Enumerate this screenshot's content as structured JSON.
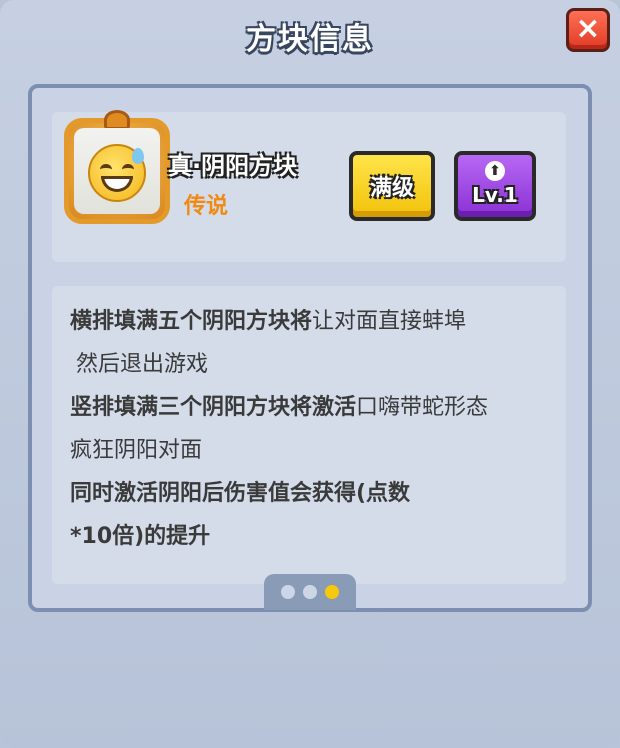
{
  "dialog": {
    "title": "方块信息",
    "close_icon": "×"
  },
  "item": {
    "name": "真·阴阳方块",
    "rarity": "传说",
    "icon": "sweat-smile-emoji-icon",
    "frame": "dragon-frame",
    "max_label": "满级",
    "level_label": "Lv.1",
    "upgrade_icon": "⬆"
  },
  "description": {
    "lines": [
      {
        "bold": "横排填满五个阴阳方块将",
        "normal": "让对面直接蚌埠"
      },
      {
        "bold": "",
        "normal": "然后退出游戏"
      },
      {
        "bold": "竖排填满三个阴阳方块将激活",
        "normal": "口嗨带蛇形态"
      },
      {
        "bold": "",
        "normal": "疯狂阴阳对面"
      },
      {
        "bold": "同时激活阴阳后伤害值会获得(点数",
        "normal": ""
      },
      {
        "bold": "*10倍)的提升",
        "normal": ""
      }
    ]
  },
  "pager": {
    "count": 3,
    "active_index": 2
  },
  "colors": {
    "panel": "#c6d0e2",
    "yellow_button": "#f2c20a",
    "purple_button": "#8a30d4",
    "close_button": "#e03a24",
    "rarity": "#f08a12"
  }
}
